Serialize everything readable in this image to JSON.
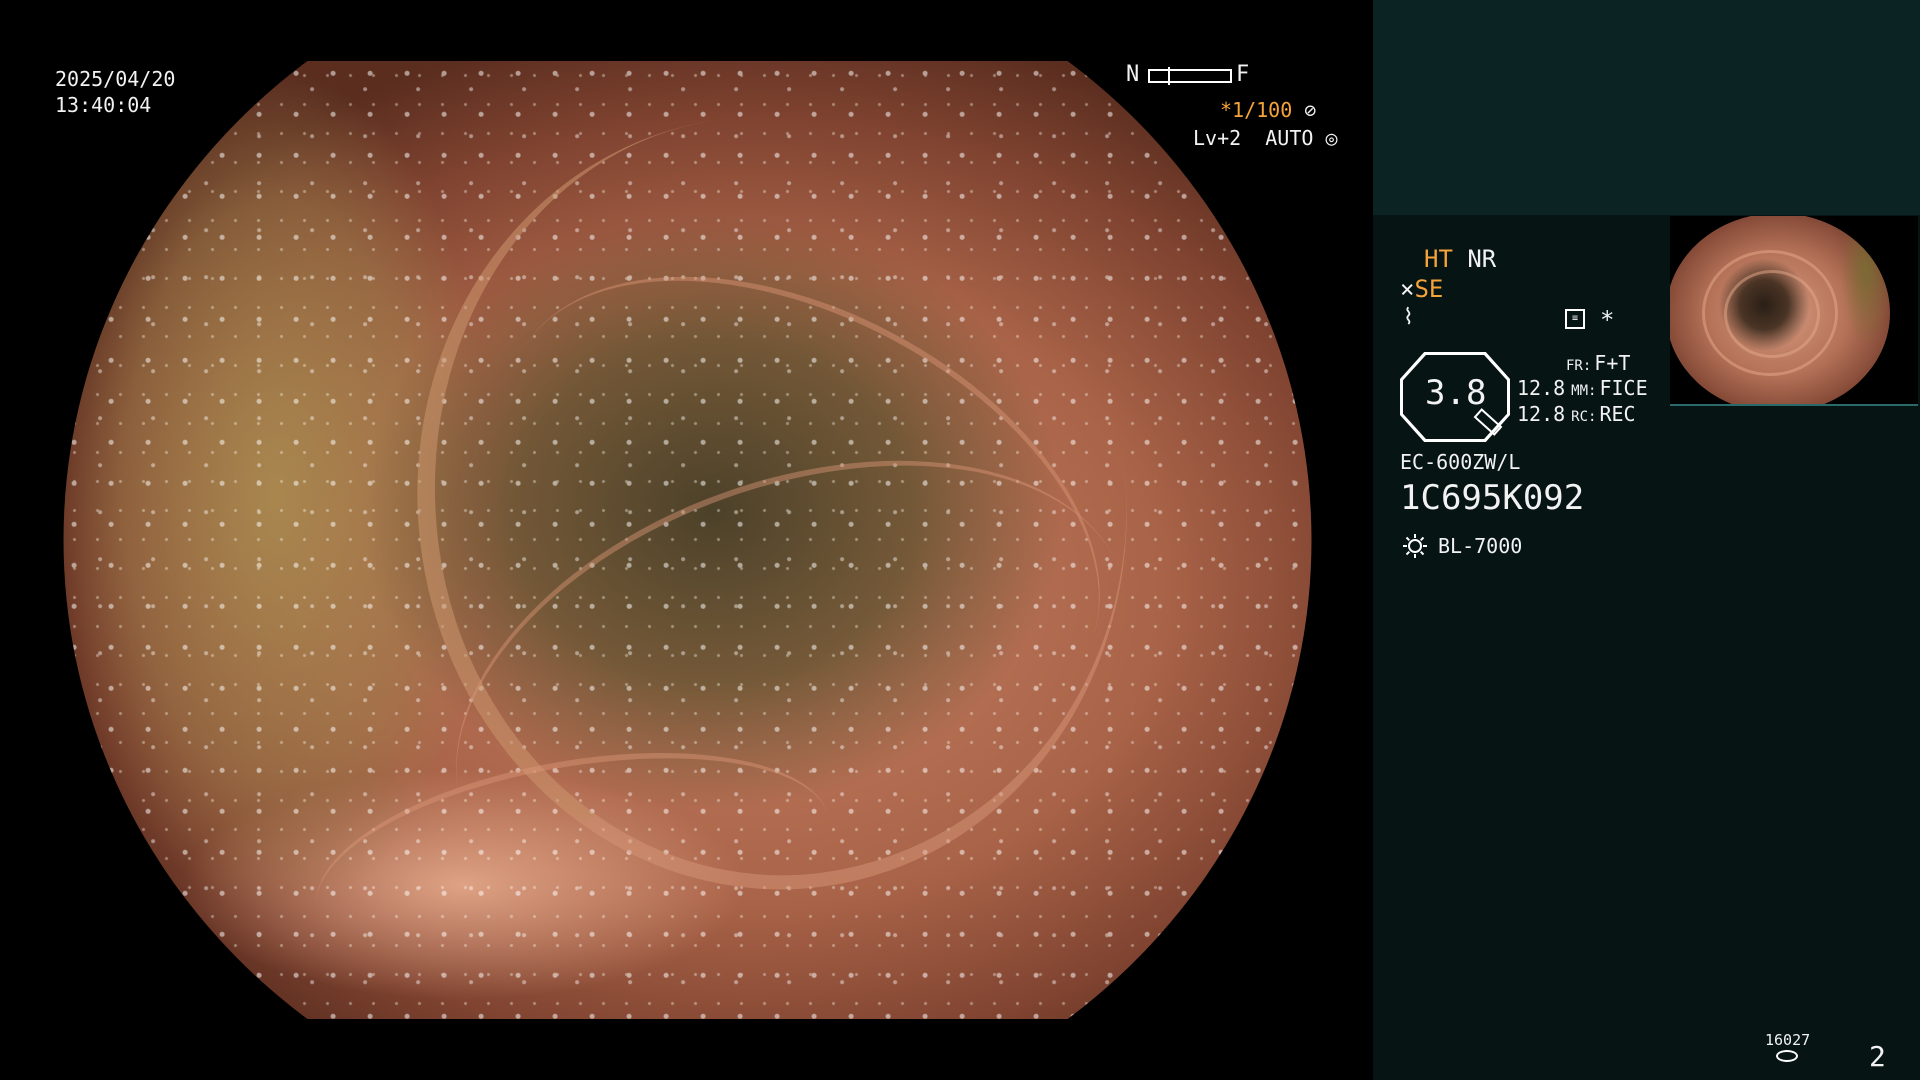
{
  "overlay": {
    "date": "2025/04/20",
    "time": "13:40:04",
    "scale_near": "N",
    "scale_far": "F",
    "shutter": "*1/100",
    "shutter_icon": "aperture-icon",
    "exposure": "Lv+2  AUTO",
    "exposure_icon": "target-icon"
  },
  "panel": {
    "ht": "HT",
    "nr": "NR",
    "se": "SE",
    "se_icon": "scope-tip-icon",
    "fz_icon": "lightning-icon",
    "rec_icon": "recording-mode-icon",
    "star": "*",
    "zoom": "3.8",
    "fr_label": "FR:",
    "fr_value": "F+T",
    "mm_num": "12.8",
    "mm_label": "MM:",
    "mm_value": "FICE",
    "rc_num": "12.8",
    "rc_label": "RC:",
    "rc_value": "REC",
    "scope_model": "EC-600ZW/L",
    "scope_serial": "1C695K092",
    "light_icon": "sun-icon",
    "light_source": "BL-7000",
    "counter": "16027",
    "counter_icon": "disk-icon",
    "page": "2"
  },
  "colors": {
    "accent_orange": "#f6a33a",
    "panel_bg": "#071414",
    "panel_top_bg": "#0c2324",
    "text": "#f2f2f2"
  }
}
